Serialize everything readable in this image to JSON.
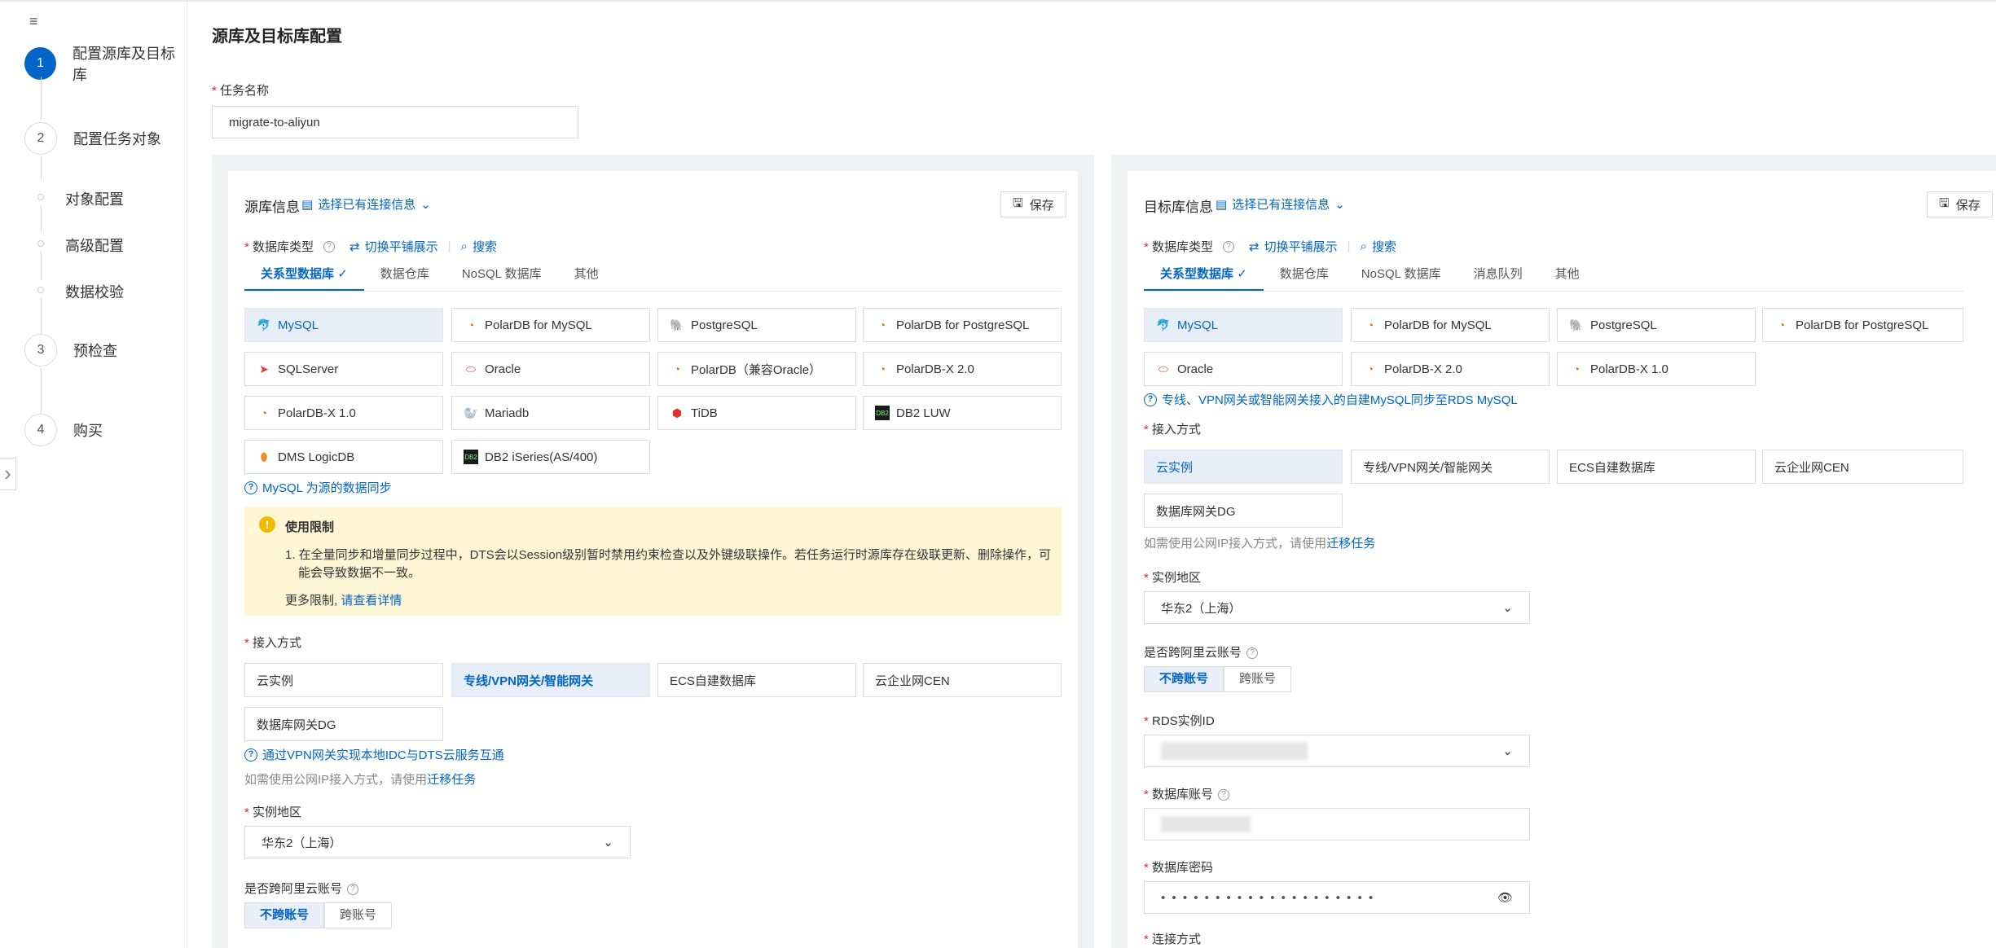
{
  "steps": [
    {
      "num": "1",
      "label": "配置源库及目标库"
    },
    {
      "num": "2",
      "label": "配置任务对象"
    },
    {
      "num": "3",
      "label": "预检查"
    },
    {
      "num": "4",
      "label": "购买"
    }
  ],
  "substeps": [
    "对象配置",
    "高级配置",
    "数据校验"
  ],
  "page_title": "源库及目标库配置",
  "task": {
    "label": "任务名称",
    "value": "migrate-to-aliyun"
  },
  "source": {
    "title": "源库信息",
    "select_conn": "选择已有连接信息",
    "save": "保存",
    "db_type_label": "数据库类型",
    "switch_view": "切换平铺展示",
    "search": "搜索",
    "tabs": [
      "关系型数据库",
      "数据仓库",
      "NoSQL 数据库",
      "其他"
    ],
    "tiles": [
      "MySQL",
      "PolarDB for MySQL",
      "PostgreSQL",
      "PolarDB for PostgreSQL",
      "SQLServer",
      "Oracle",
      "PolarDB（兼容Oracle）",
      "PolarDB-X 2.0",
      "PolarDB-X 1.0",
      "Mariadb",
      "TiDB",
      "DB2 LUW",
      "DMS LogicDB",
      "DB2 iSeries(AS/400)"
    ],
    "help_sync": "MySQL 为源的数据同步",
    "notice": {
      "title": "使用限制",
      "item1a": "1. 在全量同步和增量同步过程中，DTS会以Session级别暂时禁用约束检查以及外键级联操作。若任务运行时源库存在级联更新、删除操作，可",
      "item1b": "能会导致数据不一致。",
      "more": "更多限制,",
      "link": "请查看详情"
    },
    "access_label": "接入方式",
    "access": [
      "云实例",
      "专线/VPN网关/智能网关",
      "ECS自建数据库",
      "云企业网CEN",
      "数据库网关DG"
    ],
    "vpn_help": "通过VPN网关实现本地IDC与DTS云服务互通",
    "public_hint": "如需使用公网IP接入方式，请使用",
    "public_link": "迁移任务",
    "region_label": "实例地区",
    "region": "华东2（上海）",
    "cross_label": "是否跨阿里云账号",
    "cross": [
      "不跨账号",
      "跨账号"
    ]
  },
  "target": {
    "title": "目标库信息",
    "select_conn": "选择已有连接信息",
    "save": "保存",
    "db_type_label": "数据库类型",
    "switch_view": "切换平铺展示",
    "search": "搜索",
    "tabs": [
      "关系型数据库",
      "数据仓库",
      "NoSQL 数据库",
      "消息队列",
      "其他"
    ],
    "tiles": [
      "MySQL",
      "PolarDB for MySQL",
      "PostgreSQL",
      "PolarDB for PostgreSQL",
      "Oracle",
      "PolarDB-X 2.0",
      "PolarDB-X 1.0"
    ],
    "help_line": "专线、VPN网关或智能网关接入的自建MySQL同步至RDS MySQL",
    "access_label": "接入方式",
    "access": [
      "云实例",
      "专线/VPN网关/智能网关",
      "ECS自建数据库",
      "云企业网CEN",
      "数据库网关DG"
    ],
    "public_hint": "如需使用公网IP接入方式，请使用",
    "public_link": "迁移任务",
    "region_label": "实例地区",
    "region": "华东2（上海）",
    "cross_label": "是否跨阿里云账号",
    "cross": [
      "不跨账号",
      "跨账号"
    ],
    "rds_label": "RDS实例ID",
    "account_label": "数据库账号",
    "password_label": "数据库密码",
    "password_mask": "• • • • • • • • • • • • • • • • • • • •",
    "conn_label": "连接方式"
  },
  "colors": {
    "accent": "#0064c8",
    "required": "#e5242b",
    "notice_bg": "#fff6d6"
  }
}
